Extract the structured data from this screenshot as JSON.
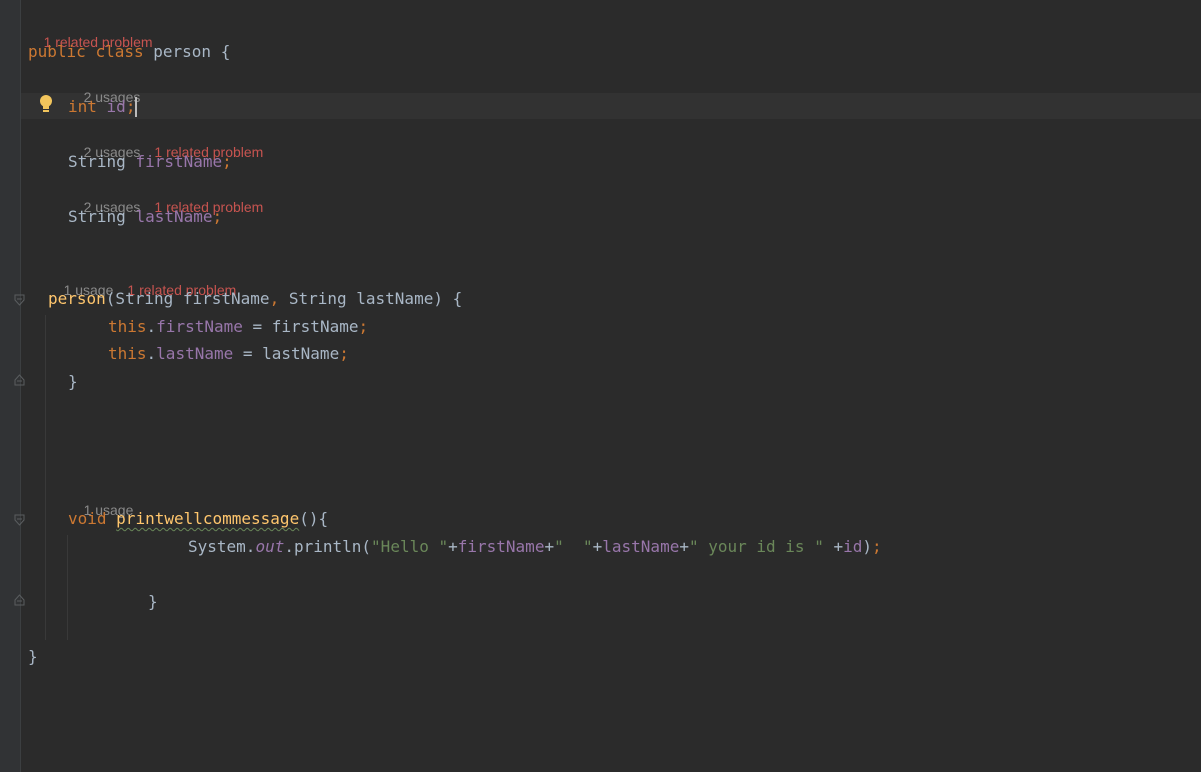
{
  "hints": {
    "class_problem": "1 related problem",
    "id_usages": "2 usages",
    "firstname_usages": "2 usages",
    "firstname_problem": "1 related problem",
    "lastname_usages": "2 usages",
    "lastname_problem": "1 related problem",
    "ctor_usage": "1 usage",
    "ctor_problem": "1 related problem",
    "method_usage": "1 usage"
  },
  "code": {
    "class_decl": {
      "kw_public": "public",
      "kw_class": "class",
      "name": "person",
      "open": "{"
    },
    "field_id": {
      "type": "int",
      "name": "id",
      "semi": ";"
    },
    "field_first": {
      "type": "String",
      "name": "firstName",
      "semi": ";"
    },
    "field_last": {
      "type": "String",
      "name": "lastName",
      "semi": ";"
    },
    "ctor": {
      "name": "person",
      "params_start": "(String firstName",
      "comma": ",",
      "params_end": " String lastName) {"
    },
    "assign_first": {
      "this": "this",
      "dot": ".",
      "field": "firstName",
      "rhs": " = firstName",
      "semi": ";"
    },
    "assign_last": {
      "this": "this",
      "dot": ".",
      "field": "lastName",
      "rhs": " = lastName",
      "semi": ";"
    },
    "ctor_close": "}",
    "method": {
      "kw_void": "void",
      "name": "printwellcommessage",
      "rest": "(){"
    },
    "println": {
      "system": "System.",
      "out": "out",
      "call": ".println(",
      "str1": "\"Hello \"",
      "plus1": "+",
      "var1": "firstName",
      "plus2": "+",
      "str2": "\"  \"",
      "plus3": "+",
      "var2": "lastName",
      "plus4": "+",
      "str3": "\" your id is \"",
      "plus5": " +",
      "var3": "id",
      "close": ")",
      "semi": ";"
    },
    "method_close": "}",
    "class_close": "}"
  },
  "icons": {
    "bulb": "lightbulb-icon",
    "fold": "fold-marker-icon"
  },
  "colors": {
    "background": "#2b2b2b",
    "keyword": "#cc7832",
    "field": "#9876aa",
    "method": "#ffc66d",
    "string": "#6a8759",
    "text": "#a9b7c6",
    "problem": "#c75450",
    "hint": "#8a8a8a"
  }
}
